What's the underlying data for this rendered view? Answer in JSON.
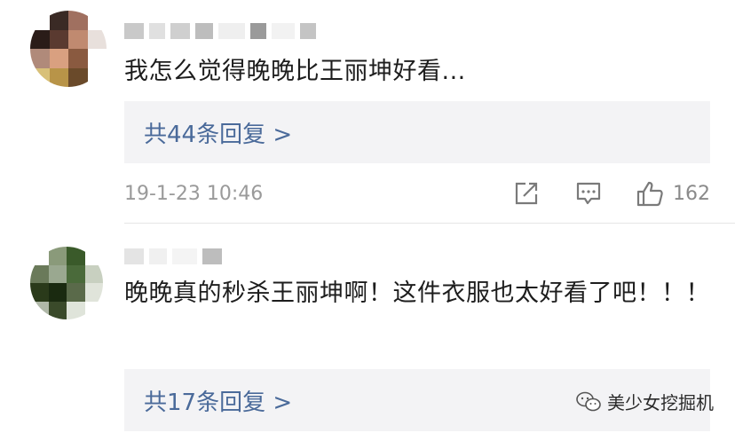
{
  "comments": [
    {
      "text": "我怎么觉得晚晚比王丽坤好看...",
      "replies_label": "共44条回复 >",
      "timestamp": "19-1-23 10:46",
      "like_count": "162"
    },
    {
      "text": "晚晚真的秒杀王丽坤啊！这件衣服也太好看了吧！！！",
      "replies_label": "共17条回复 >"
    }
  ],
  "watermark": {
    "label": "美少女挖掘机"
  },
  "colors": {
    "link": "#4a6a9a",
    "reply_bg": "#f3f3f5",
    "meta": "#9a9a9a"
  },
  "icons": [
    "share-icon",
    "comment-icon",
    "thumbs-up-icon",
    "wechat-icon"
  ]
}
